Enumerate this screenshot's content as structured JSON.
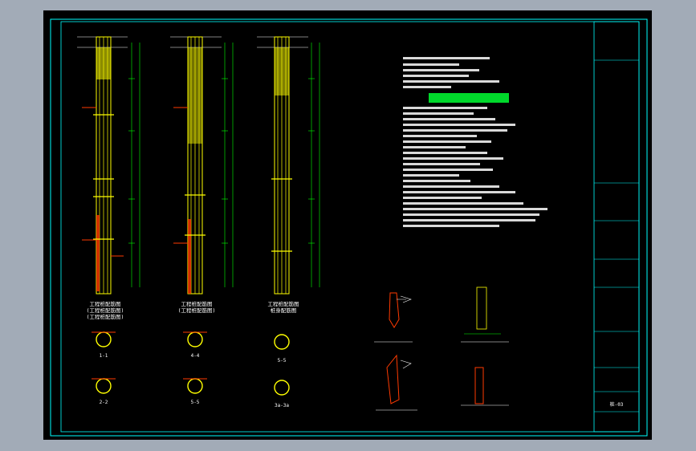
{
  "colors": {
    "background_window": "#a2abb7",
    "canvas": "#000000",
    "frame": "#00ffff",
    "pile": "#ffff00",
    "rebar": "#ff3a00",
    "dimension": "#00ff00",
    "note_text": "#ffffff",
    "highlight_text": "#00ff33"
  },
  "piles": [
    {
      "title": "工程桩配筋图",
      "sub1": "(工程桩配筋图)",
      "sub2": "(工程桩配筋图)"
    },
    {
      "title": "工程桩配筋图",
      "sub1": "(工程桩配筋图)",
      "sub2": ""
    },
    {
      "title": "工程桩配筋图",
      "sub1": "桩身配筋图",
      "sub2": ""
    }
  ],
  "sections": [
    {
      "label": "1-1"
    },
    {
      "label": "4-4"
    },
    {
      "label": "5-5"
    },
    {
      "label": "2-2"
    },
    {
      "label": "5-5"
    },
    {
      "label": "3a-3a"
    }
  ],
  "title_block": {
    "drawing_number": "桩-03"
  }
}
